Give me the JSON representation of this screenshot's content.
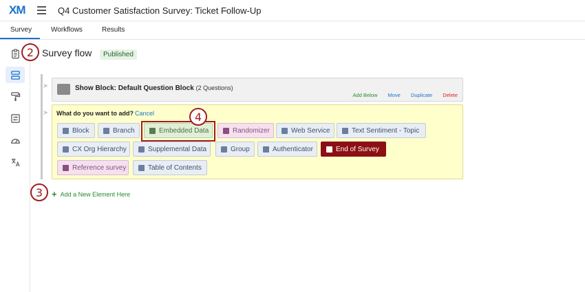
{
  "header": {
    "logo": "XM",
    "project_title": "Q4 Customer Satisfaction Survey: Ticket Follow-Up"
  },
  "tabs": [
    {
      "label": "Survey",
      "active": true
    },
    {
      "label": "Workflows",
      "active": false
    },
    {
      "label": "Results",
      "active": false
    }
  ],
  "left_rail": {
    "icons": [
      "clipboard-icon",
      "survey-flow-icon",
      "paint-roller-icon",
      "options-icon",
      "dashboard-gauge-icon",
      "translate-icon"
    ],
    "active": "survey-flow-icon"
  },
  "page": {
    "title": "Survey flow",
    "status_badge": "Published"
  },
  "callouts": {
    "c2": "2",
    "c3": "3",
    "c4": "4"
  },
  "block": {
    "title": "Show Block: Default Question Block",
    "count": "(2 Questions)",
    "actions": {
      "add_below": "Add Below",
      "move": "Move",
      "duplicate": "Duplicate",
      "delete": "Delete"
    }
  },
  "add_panel": {
    "question": "What do you want to add?",
    "cancel": "Cancel",
    "options": [
      {
        "label": "Block",
        "icon": "cube-icon"
      },
      {
        "label": "Branch",
        "icon": "branch-icon"
      },
      {
        "label": "Embedded Data",
        "icon": "embedded-data-icon"
      },
      {
        "label": "Randomizer",
        "icon": "shuffle-icon"
      },
      {
        "label": "Web Service",
        "icon": "web-service-icon"
      },
      {
        "label": "Text Sentiment - Topic",
        "icon": "sentiment-icon"
      },
      {
        "label": "CX Org Hierarchy",
        "icon": "hierarchy-icon"
      },
      {
        "label": "Supplemental Data",
        "icon": "database-icon"
      },
      {
        "label": "Group",
        "icon": "folder-icon"
      },
      {
        "label": "Authenticator",
        "icon": "lock-icon"
      },
      {
        "label": "End of Survey",
        "icon": "warning-icon"
      },
      {
        "label": "Reference survey",
        "icon": "reference-icon"
      },
      {
        "label": "Table of Contents",
        "icon": "table-icon"
      }
    ]
  },
  "add_element": "Add a New Element Here",
  "colors": {
    "accent": "#1a73c9",
    "callout": "#a01c22",
    "end_of_survey": "#8b0f13",
    "panel_yellow": "#ffffcc"
  }
}
